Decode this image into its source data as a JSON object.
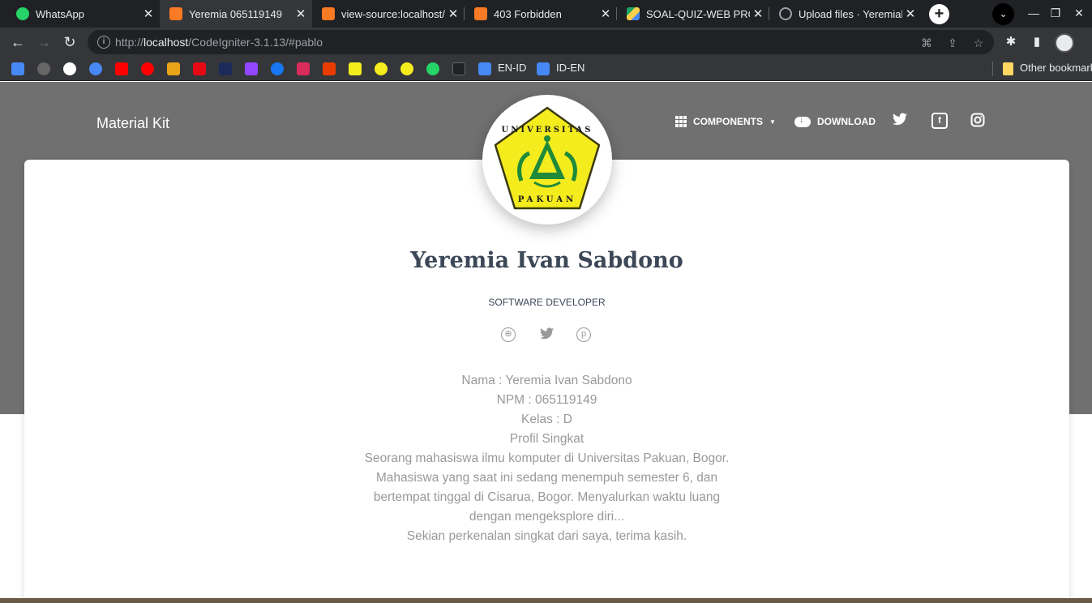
{
  "browser": {
    "tabs": [
      {
        "title": "WhatsApp",
        "favicon": "whatsapp-icon",
        "active": false
      },
      {
        "title": "Yeremia 065119149",
        "favicon": "xampp-icon",
        "active": true
      },
      {
        "title": "view-source:localhost/C",
        "favicon": "xampp-icon",
        "active": false
      },
      {
        "title": "403 Forbidden",
        "favicon": "xampp-icon",
        "active": false
      },
      {
        "title": "SOAL-QUIZ-WEB PROG",
        "favicon": "google-drive-icon",
        "active": false
      },
      {
        "title": "Upload files · Yeremialv",
        "favicon": "github-icon",
        "active": false
      }
    ],
    "url_prefix": "http://",
    "url_host": "localhost",
    "url_path": "/CodeIgniter-3.1.13/#pablo",
    "bookmarks": [
      {
        "label": "EN-ID",
        "icon": "google-translate-icon"
      },
      {
        "label": "ID-EN",
        "icon": "google-translate-icon"
      }
    ],
    "other_bookmarks": "Other bookmarks"
  },
  "site": {
    "brand": "Material Kit",
    "nav": {
      "components": "COMPONENTS",
      "download": "DOWNLOAD"
    }
  },
  "profile": {
    "name": "Yeremia Ivan Sabdono",
    "job_title": "SOFTWARE DEVELOPER",
    "avatar_logo_text": "UNIVERSITAS PAKUAN",
    "social": [
      "dribbble-icon",
      "twitter-icon",
      "pinterest-icon"
    ]
  },
  "description": {
    "nama": "Nama : Yeremia Ivan Sabdono",
    "npm": "NPM : 065119149",
    "kelas": "Kelas : D",
    "heading": "Profil Singkat",
    "bio": "Seorang mahasiswa ilmu komputer di Universitas Pakuan, Bogor. Mahasiswa yang saat ini sedang menempuh semester 6, dan bertempat tinggal di Cisarua, Bogor. Menyalurkan waktu luang dengan mengeksplore diri...",
    "closing": "Sekian perkenalan singkat dari saya, terima kasih."
  },
  "colors": {
    "hero_bg": "#707070",
    "name_text": "#3c4858",
    "desc_text": "#999999",
    "logo_yellow": "#f5ec1e",
    "logo_green": "#1f8a3a"
  }
}
